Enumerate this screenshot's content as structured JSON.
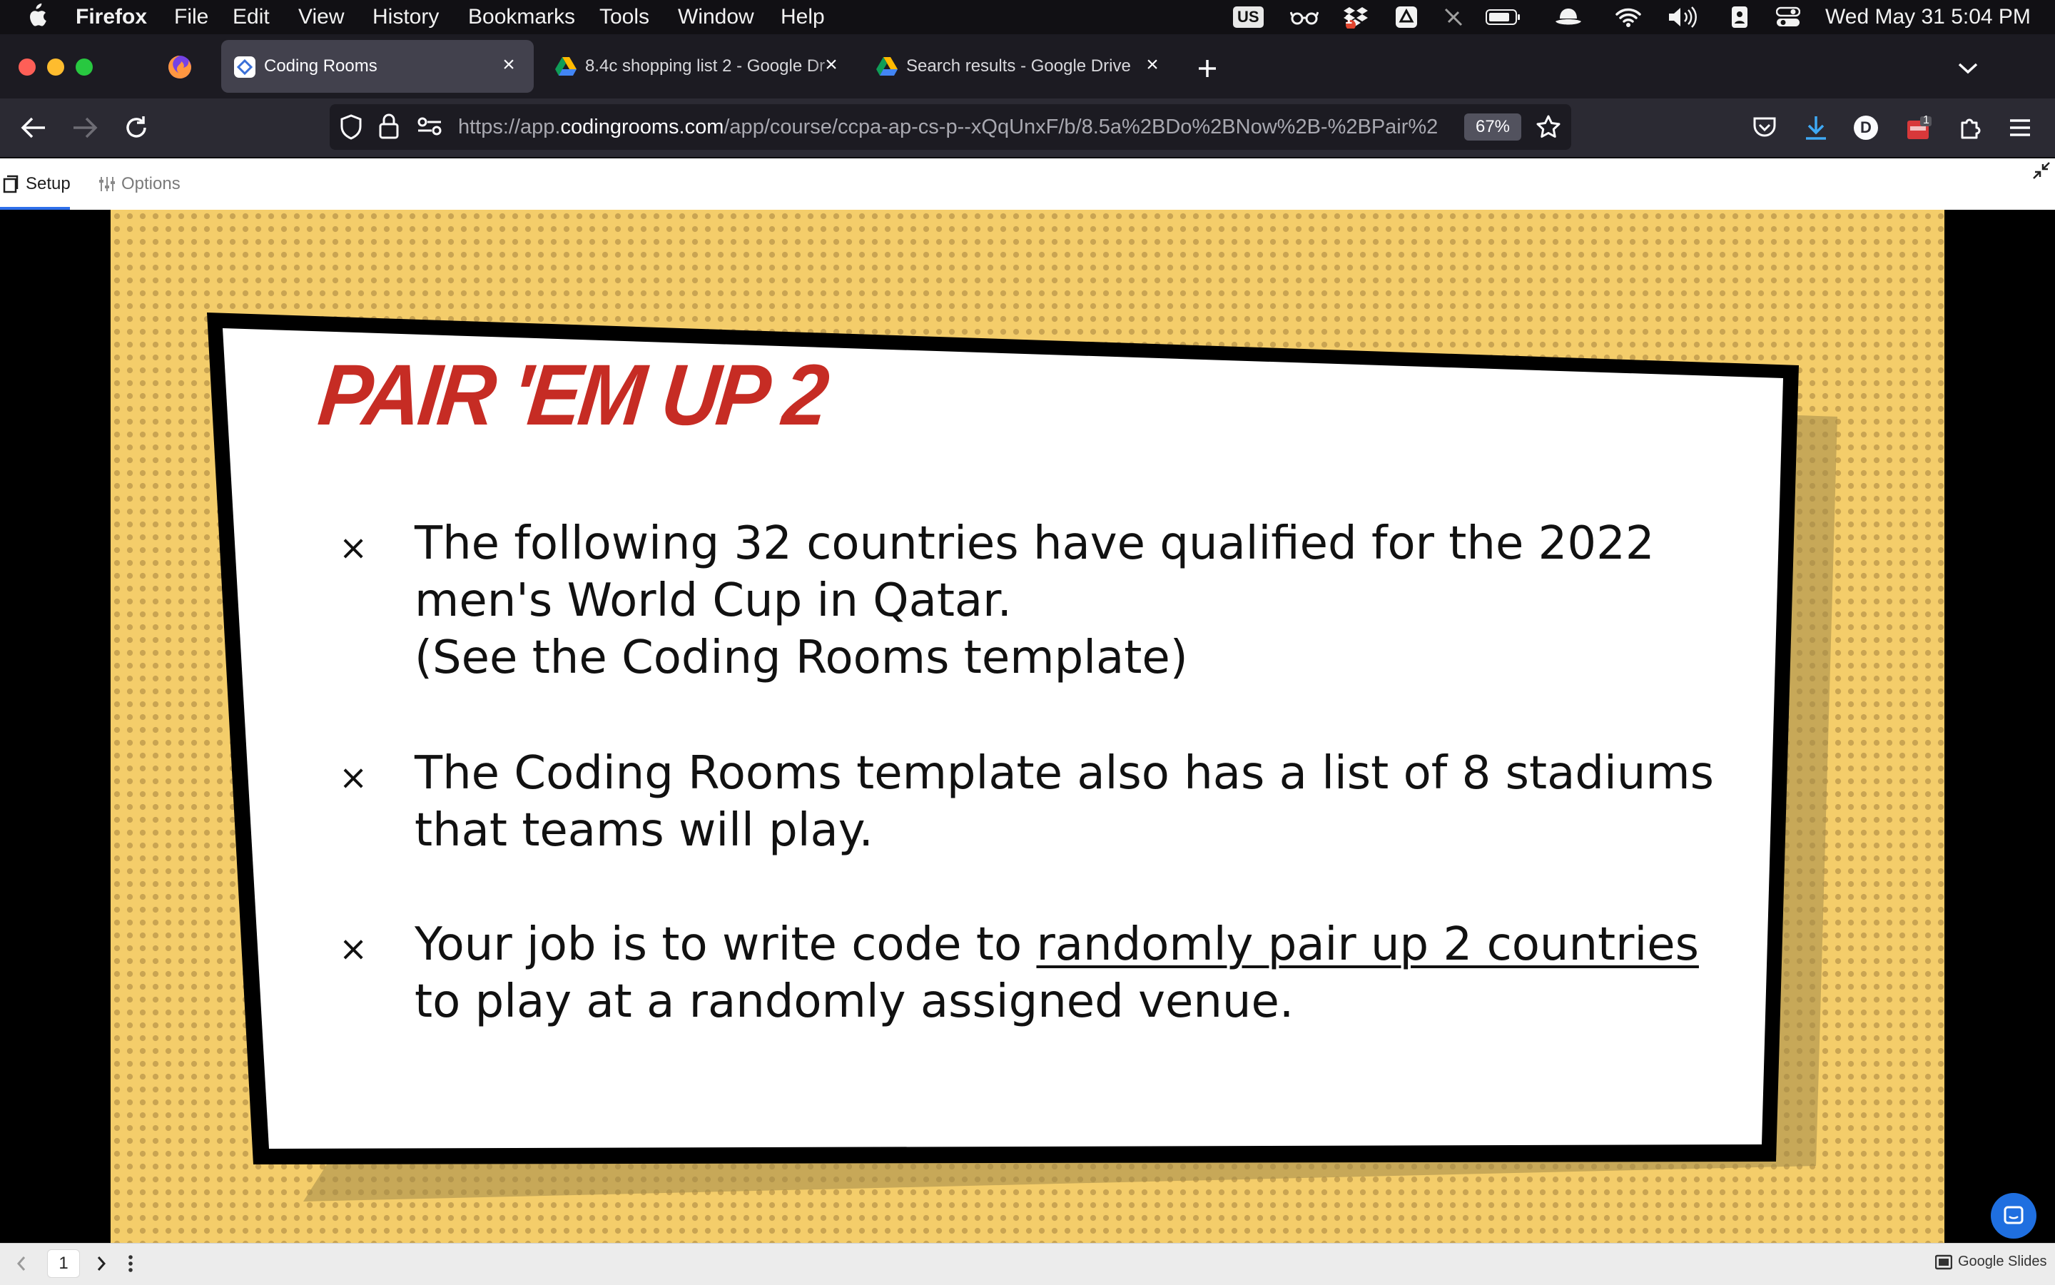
{
  "menubar": {
    "app_name": "Firefox",
    "menus": [
      "File",
      "Edit",
      "View",
      "History",
      "Bookmarks",
      "Tools",
      "Window",
      "Help"
    ],
    "input_source": "US",
    "notification_badge": "1",
    "datetime": "Wed May 31  5:04 PM"
  },
  "tabs": [
    {
      "title": "Coding Rooms",
      "active": true,
      "icon": "coding-rooms-icon"
    },
    {
      "title": "8.4c shopping list 2 - Google Dr",
      "active": false,
      "icon": "google-drive-icon"
    },
    {
      "title": "Search results - Google Drive",
      "active": false,
      "icon": "google-drive-icon"
    }
  ],
  "navbar": {
    "url_prefix": "https://app.",
    "url_host": "codingrooms.com",
    "url_path": "/app/course/ccpa-ap-cs-p--xQqUnxF/b/8.5a%2BDo%2BNow%2B-%2BPair%2",
    "zoom": "67%",
    "profile_initial": "D",
    "extension_badge": "1"
  },
  "toolbar": {
    "setup_label": "Setup",
    "options_label": "Options"
  },
  "slide": {
    "title": "PAIR 'EM UP 2",
    "bullet1_line1": "The following 32 countries have qualified for the 2022",
    "bullet1_line2": "men's World Cup in Qatar.",
    "bullet1_line3": "(See the Coding Rooms template)",
    "bullet2_line1": "The Coding Rooms template also has a list of 8 stadiums",
    "bullet2_line2": "that teams will play.",
    "bullet3_line1_pre": "Your job is to write code to ",
    "bullet3_line1_underlined": "randomly pair up 2 countries",
    "bullet3_line2": "to play at a randomly assigned venue.",
    "bullet_marker": "×"
  },
  "bottombar": {
    "page_number": "1",
    "brand": "Google Slides"
  },
  "colors": {
    "title_red": "#c62c24",
    "slide_yellow": "#f4cd6a",
    "active_tab": "#42414d"
  }
}
